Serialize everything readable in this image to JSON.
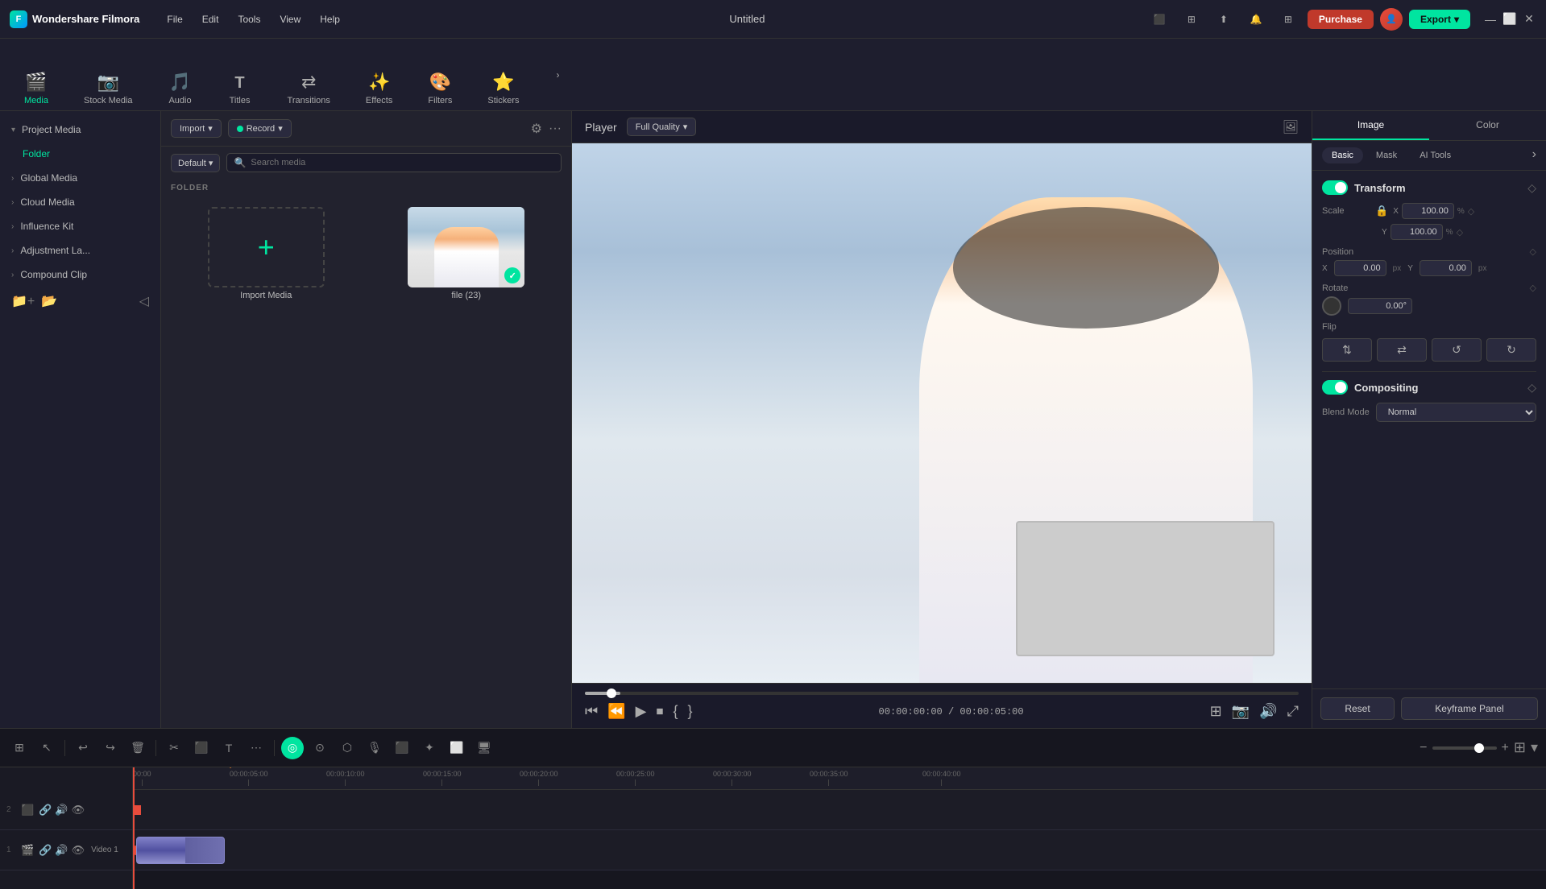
{
  "app": {
    "name": "Wondershare Filmora",
    "title": "Untitled",
    "logo_text": "F"
  },
  "topbar": {
    "menu": [
      "File",
      "Edit",
      "Tools",
      "View",
      "Help"
    ],
    "purchase_label": "Purchase",
    "export_label": "Export",
    "icons": [
      "monitor",
      "grid",
      "upload",
      "bell",
      "apps"
    ]
  },
  "toolbar": {
    "items": [
      {
        "id": "media",
        "label": "Media",
        "icon": "🎬"
      },
      {
        "id": "stock",
        "label": "Stock Media",
        "icon": "📷"
      },
      {
        "id": "audio",
        "label": "Audio",
        "icon": "🎵"
      },
      {
        "id": "titles",
        "label": "Titles",
        "icon": "T"
      },
      {
        "id": "transitions",
        "label": "Transitions",
        "icon": "⇄"
      },
      {
        "id": "effects",
        "label": "Effects",
        "icon": "✨"
      },
      {
        "id": "filters",
        "label": "Filters",
        "icon": "🎨"
      },
      {
        "id": "stickers",
        "label": "Stickers",
        "icon": "⭐"
      }
    ],
    "more_icon": "›"
  },
  "sidebar": {
    "items": [
      {
        "id": "project-media",
        "label": "Project Media",
        "expanded": true
      },
      {
        "id": "folder",
        "label": "Folder",
        "active": true
      },
      {
        "id": "global-media",
        "label": "Global Media"
      },
      {
        "id": "cloud-media",
        "label": "Cloud Media"
      },
      {
        "id": "influence-kit",
        "label": "Influence Kit"
      },
      {
        "id": "adjustment-la",
        "label": "Adjustment La..."
      },
      {
        "id": "compound-clip",
        "label": "Compound Clip"
      }
    ]
  },
  "media_panel": {
    "import_label": "Import",
    "record_label": "Record",
    "default_select": "Default",
    "search_placeholder": "Search media",
    "folder_label": "FOLDER",
    "items": [
      {
        "id": "import",
        "type": "add",
        "name": "Import Media"
      },
      {
        "id": "file23",
        "type": "video",
        "name": "file (23)",
        "has_check": true
      }
    ]
  },
  "player": {
    "label": "Player",
    "quality": "Full Quality",
    "time_current": "00:00:00:00",
    "time_total": "00:00:05:00",
    "controls": [
      "skip-back",
      "frame-back",
      "play",
      "stop",
      "mark-in",
      "mark-out",
      "add-to-timeline",
      "camera",
      "volume",
      "fullscreen"
    ]
  },
  "right_panel": {
    "tabs": [
      "Image",
      "Color"
    ],
    "subtabs": [
      "Basic",
      "Mask",
      "AI Tools"
    ],
    "sections": {
      "transform": {
        "title": "Transform",
        "enabled": true,
        "scale": {
          "x_label": "X",
          "x_value": "100.00",
          "y_label": "Y",
          "y_value": "100.00",
          "unit": "%"
        },
        "position": {
          "label": "Position",
          "x_label": "X",
          "x_value": "0.00",
          "y_label": "Y",
          "y_value": "0.00",
          "unit": "px"
        },
        "rotate": {
          "label": "Rotate",
          "value": "0.00°"
        },
        "flip": {
          "label": "Flip",
          "buttons": [
            "⇅",
            "⇄",
            "↺",
            "↻"
          ]
        }
      },
      "compositing": {
        "title": "Compositing",
        "enabled": true,
        "blend_mode_label": "Blend Mode",
        "blend_mode_value": "Normal"
      }
    },
    "buttons": {
      "reset": "Reset",
      "keyframe": "Keyframe Panel"
    }
  },
  "timeline": {
    "toolbar_icons": [
      "grid",
      "select",
      "undo",
      "redo",
      "delete",
      "cut",
      "trim",
      "text",
      "expand"
    ],
    "zoom_level": 65,
    "ruler_marks": [
      "00:00",
      "00:00:05:00",
      "00:00:10:00",
      "00:00:15:00",
      "00:00:20:00",
      "00:00:25:00",
      "00:00:30:00",
      "00:00:35:00",
      "00:00:40:00"
    ],
    "tracks": [
      {
        "id": 2,
        "type": "audio-video",
        "has_clip": false
      },
      {
        "id": 1,
        "type": "video",
        "label": "Video 1",
        "has_clip": true
      }
    ]
  },
  "arrow": {
    "color": "#e67e22",
    "visible": true
  }
}
